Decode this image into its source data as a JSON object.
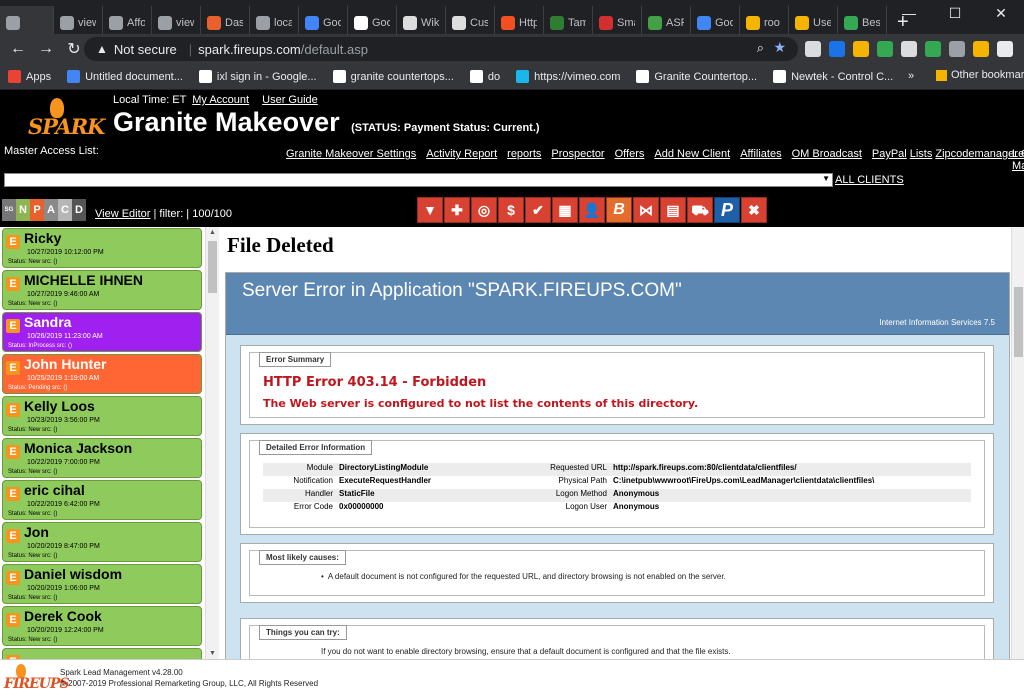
{
  "browser": {
    "tabs": [
      {
        "label": "",
        "color": "#9aa0a6",
        "active": true
      },
      {
        "label": "view",
        "color": "#9aa0a6"
      },
      {
        "label": "Affo",
        "color": "#9aa0a6"
      },
      {
        "label": "view",
        "color": "#9aa0a6"
      },
      {
        "label": "Das",
        "color": "#e8612c"
      },
      {
        "label": "loca",
        "color": "#9aa0a6"
      },
      {
        "label": "Goo",
        "color": "#4285f4"
      },
      {
        "label": "Goo",
        "color": "#ffffff"
      },
      {
        "label": "Wik",
        "color": "#dddddd"
      },
      {
        "label": "Cus",
        "color": "#dddddd"
      },
      {
        "label": "Http",
        "color": "#f25022"
      },
      {
        "label": "Tam",
        "color": "#2e7d32"
      },
      {
        "label": "Sma",
        "color": "#d32f2f"
      },
      {
        "label": "ASF",
        "color": "#43a047"
      },
      {
        "label": "Goo",
        "color": "#4285f4"
      },
      {
        "label": "roo",
        "color": "#f4b400"
      },
      {
        "label": "Use",
        "color": "#f4b400"
      },
      {
        "label": "Bes",
        "color": "#34a853"
      }
    ],
    "new_tab": "+",
    "window_controls": [
      "—",
      "☐",
      "✕"
    ],
    "address": {
      "security": "Not secure",
      "host": "spark.fireups.com",
      "path": "/default.asp"
    },
    "bookmarks": [
      {
        "label": "Apps",
        "color": "#ea4335"
      },
      {
        "label": "Untitled document...",
        "color": "#4285f4"
      },
      {
        "label": "ixl sign in - Google...",
        "color": "#ffffff"
      },
      {
        "label": "granite countertops...",
        "color": "#ffffff"
      },
      {
        "label": "do",
        "color": "#ffffff"
      },
      {
        "label": "https://vimeo.com",
        "color": "#1ab7ea"
      },
      {
        "label": "Granite Countertop...",
        "color": "#ffffff"
      },
      {
        "label": "Newtek - Control C...",
        "color": "#ffffff"
      }
    ],
    "bookmarks_more": "»",
    "other_bookmarks": "Other bookmarks"
  },
  "app": {
    "logo_text": "SPARK",
    "local_time_label": "Local Time: ET",
    "my_account": "My Account",
    "user_guide": "User Guide",
    "title": "Granite Makeover",
    "status": "(STATUS: Payment Status: Current.)",
    "master_access_label": "Master Access List:",
    "nav": [
      "Granite Makeover Settings",
      "Activity Report",
      "reports",
      "Prospector",
      "Offers",
      "Add New Client",
      "Affiliates",
      "OM Broadcast",
      "PayPal",
      "Lists",
      "Zipcodemanager",
      "Colors"
    ],
    "nav_wrap": [
      "Le",
      "Mana"
    ],
    "select_arrow": "▼",
    "all_clients": "ALL CLIENTS"
  },
  "filter": {
    "letters": [
      {
        "l": "SG",
        "c": "#777777"
      },
      {
        "l": "N",
        "c": "#8fb552"
      },
      {
        "l": "P",
        "c": "#e8612c"
      },
      {
        "l": "A",
        "c": "#8a8a8a"
      },
      {
        "l": "C",
        "c": "#b6b6b6"
      },
      {
        "l": "D",
        "c": "#555555"
      }
    ],
    "view_editor": "View Editor",
    "filter_text": "| filter: | 100/100",
    "icons": [
      {
        "n": "funnel-icon",
        "g": "▼",
        "cls": ""
      },
      {
        "n": "plus-icon",
        "g": "✚",
        "cls": ""
      },
      {
        "n": "target-icon",
        "g": "◎",
        "cls": ""
      },
      {
        "n": "dollar-icon",
        "g": "$",
        "cls": ""
      },
      {
        "n": "checklist-icon",
        "g": "✔",
        "cls": ""
      },
      {
        "n": "grid-icon",
        "g": "▦",
        "cls": ""
      },
      {
        "n": "user-icon",
        "g": "👤",
        "cls": ""
      },
      {
        "n": "b-icon",
        "g": "B",
        "cls": "b"
      },
      {
        "n": "merge-icon",
        "g": "⋈",
        "cls": ""
      },
      {
        "n": "document-icon",
        "g": "▤",
        "cls": ""
      },
      {
        "n": "truck-icon",
        "g": "⛟",
        "cls": ""
      },
      {
        "n": "paypal-icon",
        "g": "P",
        "cls": "p"
      },
      {
        "n": "close-icon",
        "g": "✖",
        "cls": ""
      }
    ]
  },
  "leads": [
    {
      "name": "Ricky",
      "date": "10/27/2019 10:12:00 PM",
      "status": "Status: New src: ()",
      "color": "#8fca5c"
    },
    {
      "name": "MICHELLE IHNEN",
      "date": "10/27/2019 9:46:00 AM",
      "status": "Status: New src: ()",
      "color": "#8fca5c"
    },
    {
      "name": "Sandra",
      "date": "10/26/2019 11:23:00 AM",
      "status": "Status: InProcess src: ()",
      "color": "#a020f0",
      "text": "#ffffff"
    },
    {
      "name": "John Hunter",
      "date": "10/25/2019 1:19:00 AM",
      "status": "Status: Pending src: ()",
      "color": "#ff6633",
      "text": "#ffffff"
    },
    {
      "name": "Kelly Loos",
      "date": "10/23/2019 3:56:00 PM",
      "status": "Status: New src: ()",
      "color": "#8fca5c"
    },
    {
      "name": "Monica Jackson",
      "date": "10/22/2019 7:00:00 PM",
      "status": "Status: New src: ()",
      "color": "#8fca5c"
    },
    {
      "name": "eric cihal",
      "date": "10/22/2019 6:42:00 PM",
      "status": "Status: New src: ()",
      "color": "#8fca5c"
    },
    {
      "name": "Jon",
      "date": "10/20/2019 8:47:00 PM",
      "status": "Status: New src: ()",
      "color": "#8fca5c"
    },
    {
      "name": "Daniel wisdom",
      "date": "10/20/2019 1:06:00 PM",
      "status": "Status: New src: ()",
      "color": "#8fca5c"
    },
    {
      "name": "Derek Cook",
      "date": "10/20/2019 12:24:00 PM",
      "status": "Status: New src: ()",
      "color": "#8fca5c"
    },
    {
      "name": "",
      "date": "",
      "status": "",
      "color": "#8fca5c"
    }
  ],
  "main": {
    "heading": "File Deleted",
    "iis": {
      "title": "Server Error in Application \"SPARK.FIREUPS.COM\"",
      "subtitle": "Internet Information Services 7.5",
      "summary_legend": "Error Summary",
      "error_title": "HTTP Error 403.14 - Forbidden",
      "error_message": "The Web server is configured to not list the contents of this directory.",
      "detail_legend": "Detailed Error Information",
      "details": [
        {
          "k1": "Module",
          "v1": "DirectoryListingModule",
          "k2": "Requested URL",
          "v2": "http://spark.fireups.com:80/clientdata/clientfiles/"
        },
        {
          "k1": "Notification",
          "v1": "ExecuteRequestHandler",
          "k2": "Physical Path",
          "v2": "C:\\inetpub\\wwwroot\\FireUps.com\\LeadManager\\clientdata\\clientfiles\\"
        },
        {
          "k1": "Handler",
          "v1": "StaticFile",
          "k2": "Logon Method",
          "v2": "Anonymous"
        },
        {
          "k1": "Error Code",
          "v1": "0x00000000",
          "k2": "Logon User",
          "v2": "Anonymous"
        }
      ],
      "causes_legend": "Most likely causes:",
      "cause": "A default document is not configured for the requested URL, and directory browsing is not enabled on the server.",
      "try_legend": "Things you can try:",
      "try_line": "If you do not want to enable directory browsing, ensure that a default document is configured and that the file exists."
    }
  },
  "footer": {
    "logo_text": "FIREUPS",
    "version": "Spark Lead Management v4.28.00",
    "copyright": "© 2007-2019 Professional Remarketing Group, LLC, All Rights Reserved"
  }
}
